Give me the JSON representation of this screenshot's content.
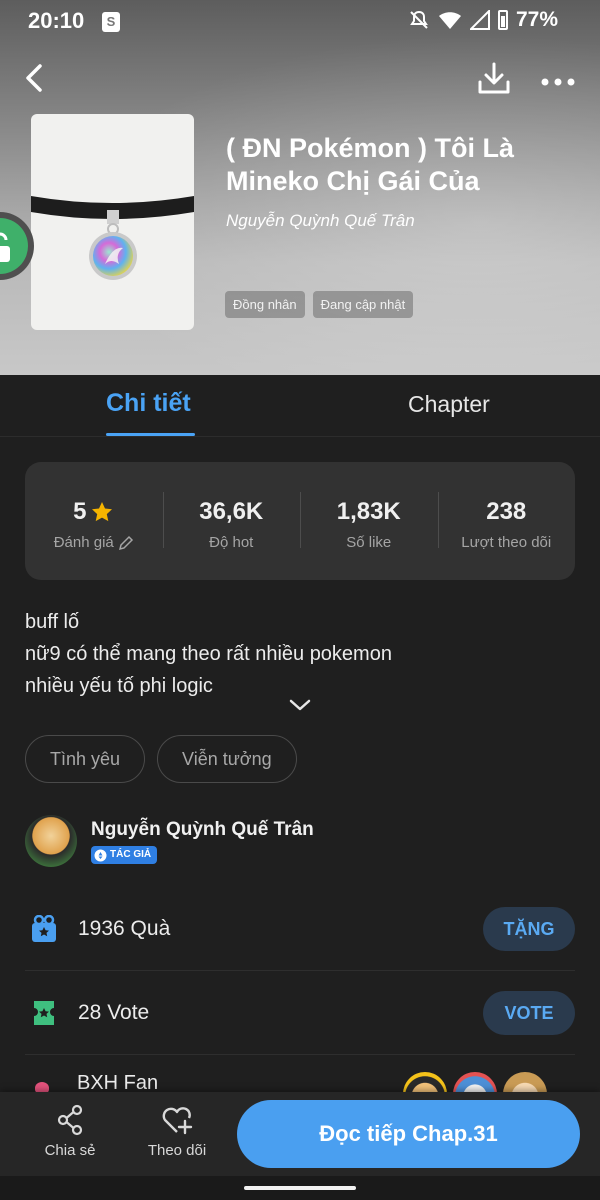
{
  "status_bar": {
    "time": "20:10",
    "battery": "77%"
  },
  "header": {
    "title": "( ĐN Pokémon ) Tôi Là Mineko Chị Gái Của",
    "author": "Nguyễn Quỳnh Quế Trân",
    "tags": [
      "Đồng nhân",
      "Đang cập nhật"
    ]
  },
  "tabs": {
    "details": "Chi tiết",
    "chapter": "Chapter"
  },
  "stats": [
    {
      "value": "5",
      "label": "Đánh giá"
    },
    {
      "value": "36,6K",
      "label": "Độ hot"
    },
    {
      "value": "1,83K",
      "label": "Số like"
    },
    {
      "value": "238",
      "label": "Lượt theo dõi"
    }
  ],
  "description": [
    "buff lố",
    "nữ9 có thể mang theo rất nhiều pokemon",
    "nhiều yếu tố phi logic"
  ],
  "genres": [
    "Tình yêu",
    "Viễn tưởng"
  ],
  "author_card": {
    "name": "Nguyễn Quỳnh Quế Trân",
    "badge": "TÁC GIẢ"
  },
  "gift": {
    "text": "1936 Quà",
    "button": "TẶNG"
  },
  "vote": {
    "text": "28 Vote",
    "button": "VOTE"
  },
  "fan": {
    "text": "BXH Fan"
  },
  "bottom": {
    "share": "Chia sẻ",
    "follow": "Theo dõi",
    "read": "Đọc tiếp Chap.31"
  },
  "colors": {
    "accent": "#4a9ff0",
    "background": "#1f1f1f",
    "card": "#323232",
    "star": "#f5b400",
    "vote_green": "#3fbf7f"
  }
}
